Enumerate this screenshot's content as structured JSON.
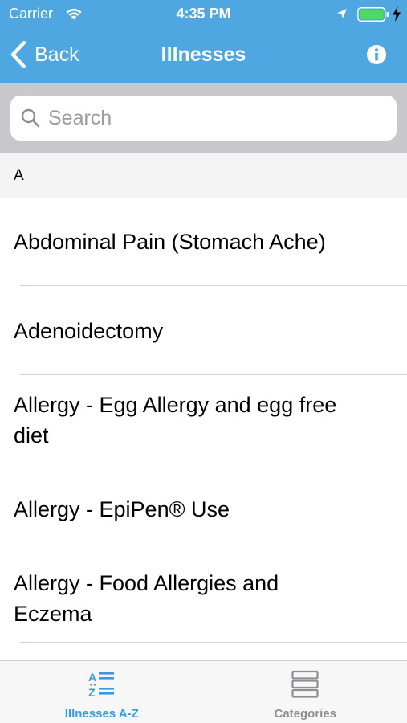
{
  "colors": {
    "nav_background": "#4fa7e2",
    "search_background": "#c8c8cc",
    "section_background": "#f4f4f4",
    "active_tab": "#3a9ae0",
    "inactive_tab": "#8e8e93"
  },
  "status_bar": {
    "carrier": "Carrier",
    "time": "4:35 PM",
    "icons": [
      "wifi-icon",
      "location-arrow-icon",
      "battery-icon",
      "charging-bolt-icon"
    ]
  },
  "nav": {
    "back_label": "Back",
    "title": "Illnesses",
    "icons": [
      "chevron-left-icon",
      "info-icon"
    ]
  },
  "search": {
    "placeholder": "Search",
    "value": "",
    "icon": "magnifying-glass-icon"
  },
  "section": {
    "header": "A"
  },
  "list": {
    "items": [
      {
        "label": "Abdominal Pain (Stomach Ache)"
      },
      {
        "label": "Adenoidectomy"
      },
      {
        "label": "Allergy - Egg Allergy and egg free diet"
      },
      {
        "label": "Allergy - EpiPen® Use"
      },
      {
        "label": "Allergy - Food Allergies and Eczema"
      }
    ]
  },
  "tab_bar": {
    "tabs": [
      {
        "label": "Illnesses A-Z",
        "icon": "a-z-list-icon",
        "active": true
      },
      {
        "label": "Categories",
        "icon": "categories-stack-icon",
        "active": false
      }
    ]
  }
}
